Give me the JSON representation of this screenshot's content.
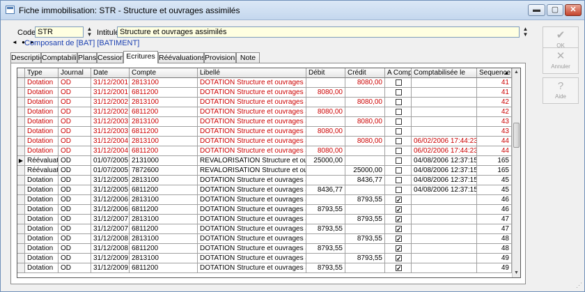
{
  "window": {
    "title": "Fiche immobilisation: STR - Structure et ouvrages assimilés",
    "controls": {
      "minimize": "▬",
      "maximize": "▢",
      "close": "✕"
    }
  },
  "header": {
    "code_label": "Code:",
    "code_value": "STR",
    "intitule_label": "Intitulé:",
    "intitule_value": "Structure et ouvrages assimilés",
    "nav_arrows": "◄ ● ►",
    "composant_link": "Composant de [BAT] [BATIMENT]"
  },
  "tabs": [
    "Description",
    "Comptabilité",
    "Plans",
    "Cession",
    "Ecritures",
    "Réévaluations",
    "Provisions",
    "Note"
  ],
  "active_tab": "Ecritures",
  "side_buttons": [
    {
      "label": "OK",
      "icon": "check-icon",
      "glyph": "✔"
    },
    {
      "label": "Annuler",
      "icon": "cancel-icon",
      "glyph": "✕"
    },
    {
      "label": "Aide",
      "icon": "help-icon",
      "glyph": "?"
    }
  ],
  "grid": {
    "columns": [
      "Type",
      "Journal",
      "Date",
      "Compte",
      "Libellé",
      "Débit",
      "Crédit",
      "A Compt.",
      "Comptabilisée le",
      "Sequence"
    ],
    "sort_indicator": "▲",
    "colors": {
      "red": "#cc0000",
      "black": "#000000",
      "current_row_marker": "▶"
    },
    "rows": [
      {
        "type": "Dotation",
        "journal": "OD",
        "date": "31/12/2001",
        "compte": "2813100",
        "libelle": "DOTATION Structure et ouvrages assimilés",
        "debit": "",
        "credit": "8080,00",
        "checked": false,
        "comptabilisee": "",
        "sequence": "41",
        "red": true,
        "current": false
      },
      {
        "type": "Dotation",
        "journal": "OD",
        "date": "31/12/2001",
        "compte": "6811200",
        "libelle": "DOTATION Structure et ouvrages assimilés",
        "debit": "8080,00",
        "credit": "",
        "checked": false,
        "comptabilisee": "",
        "sequence": "41",
        "red": true,
        "current": false
      },
      {
        "type": "Dotation",
        "journal": "OD",
        "date": "31/12/2002",
        "compte": "2813100",
        "libelle": "DOTATION Structure et ouvrages assimilés",
        "debit": "",
        "credit": "8080,00",
        "checked": false,
        "comptabilisee": "",
        "sequence": "42",
        "red": true,
        "current": false
      },
      {
        "type": "Dotation",
        "journal": "OD",
        "date": "31/12/2002",
        "compte": "6811200",
        "libelle": "DOTATION Structure et ouvrages assimilés",
        "debit": "8080,00",
        "credit": "",
        "checked": false,
        "comptabilisee": "",
        "sequence": "42",
        "red": true,
        "current": false
      },
      {
        "type": "Dotation",
        "journal": "OD",
        "date": "31/12/2003",
        "compte": "2813100",
        "libelle": "DOTATION Structure et ouvrages assimilés",
        "debit": "",
        "credit": "8080,00",
        "checked": false,
        "comptabilisee": "",
        "sequence": "43",
        "red": true,
        "current": false
      },
      {
        "type": "Dotation",
        "journal": "OD",
        "date": "31/12/2003",
        "compte": "6811200",
        "libelle": "DOTATION Structure et ouvrages assimilés",
        "debit": "8080,00",
        "credit": "",
        "checked": false,
        "comptabilisee": "",
        "sequence": "43",
        "red": true,
        "current": false
      },
      {
        "type": "Dotation",
        "journal": "OD",
        "date": "31/12/2004",
        "compte": "2813100",
        "libelle": "DOTATION Structure et ouvrages assimilés",
        "debit": "",
        "credit": "8080,00",
        "checked": false,
        "comptabilisee": "06/02/2006 17:44:23",
        "sequence": "44",
        "red": true,
        "current": false
      },
      {
        "type": "Dotation",
        "journal": "OD",
        "date": "31/12/2004",
        "compte": "6811200",
        "libelle": "DOTATION Structure et ouvrages assimilés",
        "debit": "8080,00",
        "credit": "",
        "checked": false,
        "comptabilisee": "06/02/2006 17:44:23",
        "sequence": "44",
        "red": true,
        "current": false
      },
      {
        "type": "Réévaluation",
        "journal": "OD",
        "date": "01/07/2005",
        "compte": "2131000",
        "libelle": "REVALORISATION Structure et ouvrages assimilés",
        "debit": "25000,00",
        "credit": "",
        "checked": false,
        "comptabilisee": "04/08/2006 12:37:15",
        "sequence": "165",
        "red": false,
        "current": true
      },
      {
        "type": "Réévaluation",
        "journal": "OD",
        "date": "01/07/2005",
        "compte": "7872600",
        "libelle": "REVALORISATION Structure et ouvrages assimilés",
        "debit": "",
        "credit": "25000,00",
        "checked": false,
        "comptabilisee": "04/08/2006 12:37:15",
        "sequence": "165",
        "red": false,
        "current": false
      },
      {
        "type": "Dotation",
        "journal": "OD",
        "date": "31/12/2005",
        "compte": "2813100",
        "libelle": "DOTATION Structure et ouvrages assimilés",
        "debit": "",
        "credit": "8436,77",
        "checked": false,
        "comptabilisee": "04/08/2006 12:37:15",
        "sequence": "45",
        "red": false,
        "current": false
      },
      {
        "type": "Dotation",
        "journal": "OD",
        "date": "31/12/2005",
        "compte": "6811200",
        "libelle": "DOTATION Structure et ouvrages assimilés",
        "debit": "8436,77",
        "credit": "",
        "checked": false,
        "comptabilisee": "04/08/2006 12:37:15",
        "sequence": "45",
        "red": false,
        "current": false
      },
      {
        "type": "Dotation",
        "journal": "OD",
        "date": "31/12/2006",
        "compte": "2813100",
        "libelle": "DOTATION Structure et ouvrages assimilés",
        "debit": "",
        "credit": "8793,55",
        "checked": true,
        "comptabilisee": "",
        "sequence": "46",
        "red": false,
        "current": false
      },
      {
        "type": "Dotation",
        "journal": "OD",
        "date": "31/12/2006",
        "compte": "6811200",
        "libelle": "DOTATION Structure et ouvrages assimilés",
        "debit": "8793,55",
        "credit": "",
        "checked": true,
        "comptabilisee": "",
        "sequence": "46",
        "red": false,
        "current": false
      },
      {
        "type": "Dotation",
        "journal": "OD",
        "date": "31/12/2007",
        "compte": "2813100",
        "libelle": "DOTATION Structure et ouvrages assimilés",
        "debit": "",
        "credit": "8793,55",
        "checked": true,
        "comptabilisee": "",
        "sequence": "47",
        "red": false,
        "current": false
      },
      {
        "type": "Dotation",
        "journal": "OD",
        "date": "31/12/2007",
        "compte": "6811200",
        "libelle": "DOTATION Structure et ouvrages assimilés",
        "debit": "8793,55",
        "credit": "",
        "checked": true,
        "comptabilisee": "",
        "sequence": "47",
        "red": false,
        "current": false
      },
      {
        "type": "Dotation",
        "journal": "OD",
        "date": "31/12/2008",
        "compte": "2813100",
        "libelle": "DOTATION Structure et ouvrages assimilés",
        "debit": "",
        "credit": "8793,55",
        "checked": true,
        "comptabilisee": "",
        "sequence": "48",
        "red": false,
        "current": false
      },
      {
        "type": "Dotation",
        "journal": "OD",
        "date": "31/12/2008",
        "compte": "6811200",
        "libelle": "DOTATION Structure et ouvrages assimilés",
        "debit": "8793,55",
        "credit": "",
        "checked": true,
        "comptabilisee": "",
        "sequence": "48",
        "red": false,
        "current": false
      },
      {
        "type": "Dotation",
        "journal": "OD",
        "date": "31/12/2009",
        "compte": "2813100",
        "libelle": "DOTATION Structure et ouvrages assimilés",
        "debit": "",
        "credit": "8793,55",
        "checked": true,
        "comptabilisee": "",
        "sequence": "49",
        "red": false,
        "current": false
      },
      {
        "type": "Dotation",
        "journal": "OD",
        "date": "31/12/2009",
        "compte": "6811200",
        "libelle": "DOTATION Structure et ouvrages assimilés",
        "debit": "8793,55",
        "credit": "",
        "checked": true,
        "comptabilisee": "",
        "sequence": "49",
        "red": false,
        "current": false
      }
    ]
  }
}
